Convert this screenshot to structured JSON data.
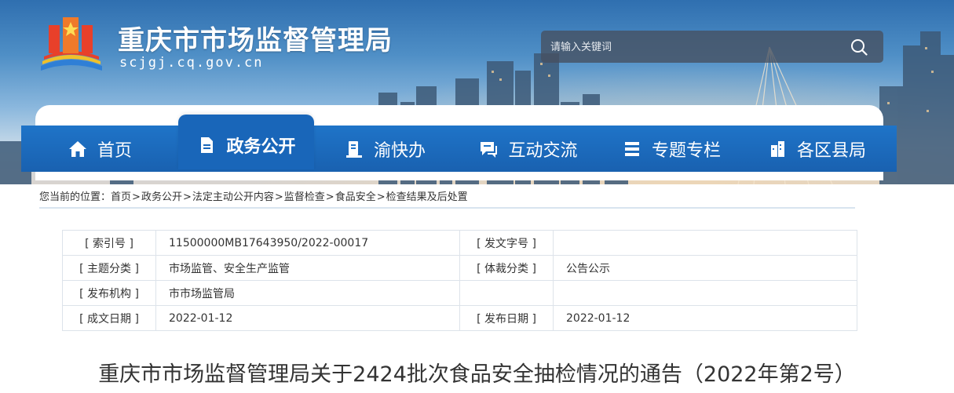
{
  "header": {
    "site_title": "重庆市市场监督管理局",
    "site_domain": "scjgj.cq.gov.cn",
    "search_placeholder": "请输入关键词"
  },
  "nav": {
    "items": [
      {
        "label": "首页",
        "icon": "home-icon"
      },
      {
        "label": "政务公开",
        "icon": "document-icon",
        "active": true
      },
      {
        "label": "渝快办",
        "icon": "service-icon"
      },
      {
        "label": "互动交流",
        "icon": "chat-icon"
      },
      {
        "label": "专题专栏",
        "icon": "column-icon"
      },
      {
        "label": "各区县局",
        "icon": "building-icon"
      }
    ]
  },
  "breadcrumb": {
    "prefix": "您当前的位置：",
    "items": [
      "首页",
      "政务公开",
      "法定主动公开内容",
      "监督检查",
      "食品安全",
      "检查结果及后处置"
    ],
    "separator": ">"
  },
  "meta": {
    "rows": [
      {
        "label1": "[ 索引号 ]",
        "value1": "11500000MB17643950/2022-00017",
        "label2": "[ 发文字号 ]",
        "value2": ""
      },
      {
        "label1": "[ 主题分类 ]",
        "value1": "市场监管、安全生产监管",
        "label2": "[ 体裁分类 ]",
        "value2": "公告公示"
      },
      {
        "label1": "[ 发布机构 ]",
        "value1": "市市场监管局",
        "label2": "",
        "value2": ""
      },
      {
        "label1": "[ 成文日期 ]",
        "value1": "2022-01-12",
        "label2": "[ 发布日期 ]",
        "value2": "2022-01-12"
      }
    ]
  },
  "document": {
    "title": "重庆市市场监督管理局关于2424批次食品安全抽检情况的通告（2022年第2号）"
  },
  "colors": {
    "nav_blue": "#1f74c8",
    "active_tab": "#1966b9",
    "text": "#333333",
    "table_border": "#dde3ea"
  }
}
